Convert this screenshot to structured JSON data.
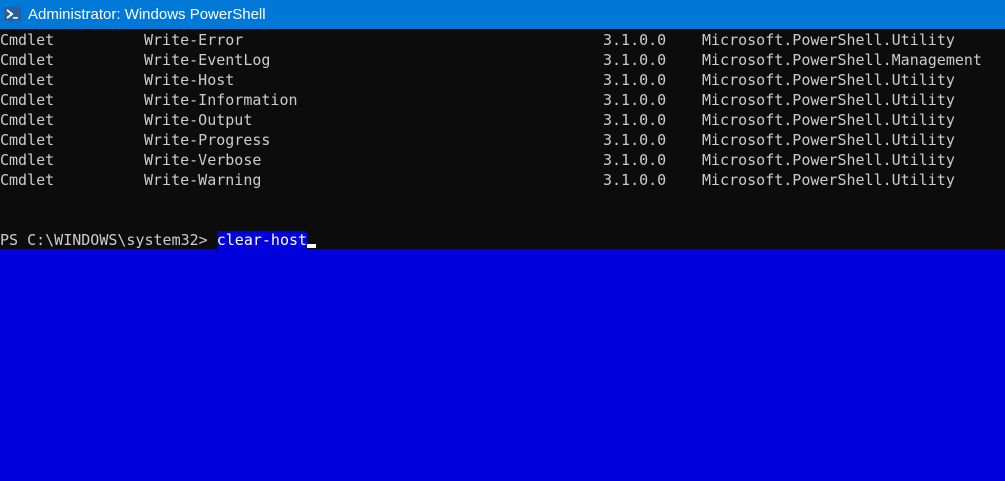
{
  "window": {
    "title": "Administrator: Windows PowerShell",
    "icon": "powershell-icon"
  },
  "rows": [
    [
      "Cmdlet",
      "Write-Error",
      "3.1.0.0",
      "Microsoft.PowerShell.Utility"
    ],
    [
      "Cmdlet",
      "Write-EventLog",
      "3.1.0.0",
      "Microsoft.PowerShell.Management"
    ],
    [
      "Cmdlet",
      "Write-Host",
      "3.1.0.0",
      "Microsoft.PowerShell.Utility"
    ],
    [
      "Cmdlet",
      "Write-Information",
      "3.1.0.0",
      "Microsoft.PowerShell.Utility"
    ],
    [
      "Cmdlet",
      "Write-Output",
      "3.1.0.0",
      "Microsoft.PowerShell.Utility"
    ],
    [
      "Cmdlet",
      "Write-Progress",
      "3.1.0.0",
      "Microsoft.PowerShell.Utility"
    ],
    [
      "Cmdlet",
      "Write-Verbose",
      "3.1.0.0",
      "Microsoft.PowerShell.Utility"
    ],
    [
      "Cmdlet",
      "Write-Warning",
      "3.1.0.0",
      "Microsoft.PowerShell.Utility"
    ]
  ],
  "prompt": {
    "path": "PS C:\\WINDOWS\\system32> ",
    "command": "clear-host"
  },
  "colors": {
    "titlebar": "#0078d7",
    "console_bg": "#0c0c0c",
    "selection": "#0000dc"
  }
}
